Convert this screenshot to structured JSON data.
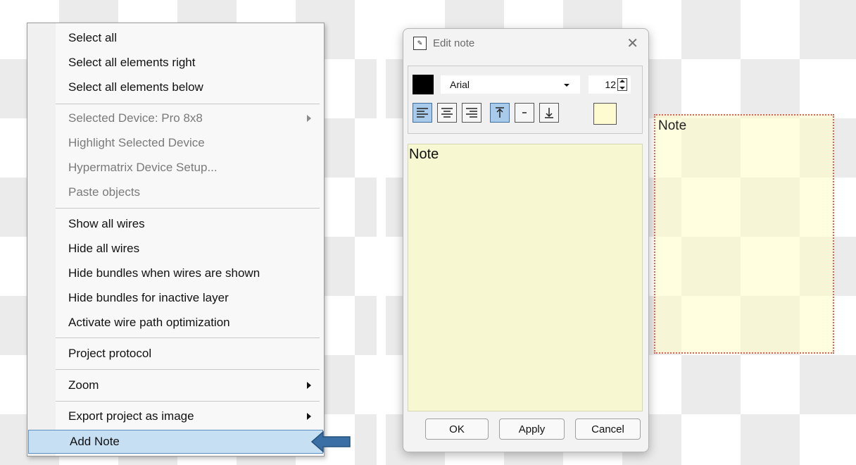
{
  "context_menu": {
    "items": [
      {
        "label": "Select all",
        "enabled": true
      },
      {
        "label": "Select all elements right",
        "enabled": true
      },
      {
        "label": "Select all elements below",
        "enabled": true
      },
      {
        "label": "Selected Device: Pro 8x8",
        "enabled": false,
        "submenu": true
      },
      {
        "label": "Highlight Selected Device",
        "enabled": false
      },
      {
        "label": "Hypermatrix Device Setup...",
        "enabled": false
      },
      {
        "label": "Paste objects",
        "enabled": false
      },
      {
        "label": "Show all wires",
        "enabled": true
      },
      {
        "label": "Hide all wires",
        "enabled": true
      },
      {
        "label": "Hide bundles when wires are shown",
        "enabled": true
      },
      {
        "label": "Hide bundles for inactive layer",
        "enabled": true
      },
      {
        "label": "Activate wire path optimization",
        "enabled": true
      },
      {
        "label": "Project protocol",
        "enabled": true
      },
      {
        "label": "Zoom",
        "enabled": true,
        "submenu": true
      },
      {
        "label": "Export project as image",
        "enabled": true,
        "submenu": true
      },
      {
        "label": "Add Note",
        "enabled": true,
        "highlighted": true
      }
    ]
  },
  "dialog": {
    "title": "Edit note",
    "close_icon": "close-icon",
    "text_color": "#000000",
    "background_color": "#fffbd0",
    "font": "Arial",
    "font_size": "12",
    "alignment": {
      "horizontal": "left",
      "vertical": "top"
    },
    "note_text": "Note",
    "buttons": {
      "ok": "OK",
      "apply": "Apply",
      "cancel": "Cancel"
    }
  },
  "canvas": {
    "note_text": "Note",
    "note_border_color": "#e06060"
  },
  "colors": {
    "highlight": "#c7dff3",
    "active_toggle": "#a8cbec",
    "pointer_arrow": "#3a6fa5"
  }
}
